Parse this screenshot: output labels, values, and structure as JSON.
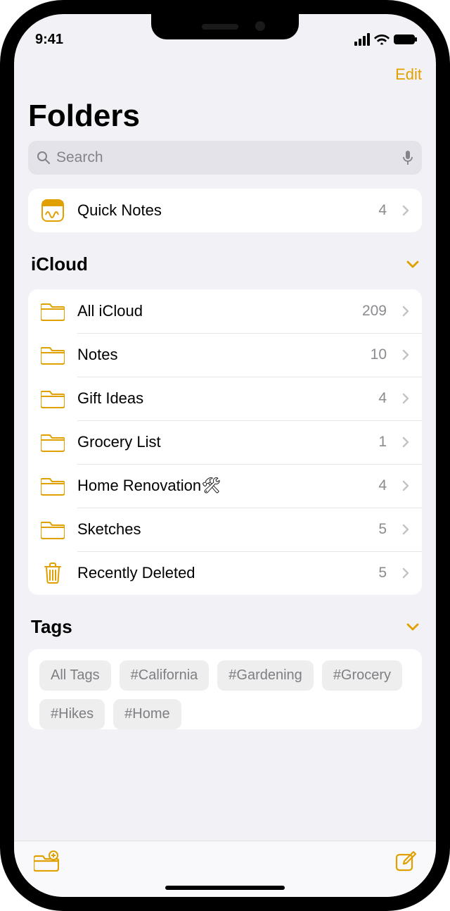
{
  "status": {
    "time": "9:41"
  },
  "nav": {
    "edit": "Edit"
  },
  "title": "Folders",
  "search": {
    "placeholder": "Search"
  },
  "quicknotes": {
    "label": "Quick Notes",
    "count": "4"
  },
  "sections": {
    "icloud": {
      "title": "iCloud",
      "items": [
        {
          "label": "All iCloud",
          "count": "209",
          "icon": "folder"
        },
        {
          "label": "Notes",
          "count": "10",
          "icon": "folder"
        },
        {
          "label": "Gift Ideas",
          "count": "4",
          "icon": "folder"
        },
        {
          "label": "Grocery List",
          "count": "1",
          "icon": "folder"
        },
        {
          "label": "Home Renovation🛠",
          "count": "4",
          "icon": "folder"
        },
        {
          "label": "Sketches",
          "count": "5",
          "icon": "folder"
        },
        {
          "label": "Recently Deleted",
          "count": "5",
          "icon": "trash"
        }
      ]
    },
    "tags": {
      "title": "Tags",
      "items": [
        "All Tags",
        "#California",
        "#Gardening",
        "#Grocery",
        "#Hikes",
        "#Home"
      ]
    }
  }
}
